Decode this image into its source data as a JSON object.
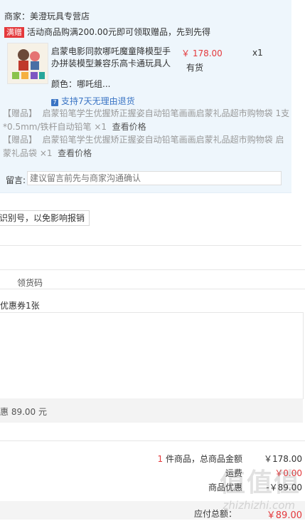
{
  "shop": {
    "label": "商家：美澄玩具专营店"
  },
  "promo": {
    "tag": "满赠",
    "text": "活动商品购满200.00元即可领取赠品，先到先得"
  },
  "product": {
    "title": "启蒙电影同款哪吒魔童降模型手办拼装模型兼容乐高卡通玩具人",
    "price": "￥ 178.00",
    "qty": "x1",
    "stock": "有货",
    "color": "颜色：哪吒组...",
    "return_policy": "支持7天无理由退货",
    "return_icon": "7"
  },
  "gifts": [
    {
      "prefix": "【赠品】",
      "name": "启蒙铅笔学生优握矫正握姿自动铅笔画画启蒙礼品超市购物袋 1支*0.5mm/铁杆自动铅笔 ×1",
      "link": "查看价格"
    },
    {
      "prefix": "【赠品】",
      "name": "启蒙铅笔学生优握矫正握姿自动铅笔画画启蒙礼品超市购物袋 启蒙礼品袋 ×1",
      "link": "查看价格"
    }
  ],
  "note": {
    "label": "留言:",
    "placeholder": "建议留言前先与商家沟通确认"
  },
  "tip": {
    "text": "识别号，以免影响报销"
  },
  "pickup": {
    "title": "领货码"
  },
  "coupon": {
    "summary": "优惠券1张",
    "discount": "惠 89.00 元"
  },
  "summary": {
    "count_prefix": "1",
    "count_text": " 件商品，总商品金额",
    "goods_total": "￥178.00",
    "row2_label": "运费",
    "row2_value": "￥0.00",
    "row3_label": "商品优惠",
    "row3_value": "-￥89.00",
    "total_label": "应付总额：",
    "total_value": "￥89.00"
  },
  "watermark": {
    "text": "值值值",
    "url": "zhizhizhi.com"
  },
  "colors": {
    "accent_red": "#e4393c",
    "link_blue": "#3a74c4",
    "panel_bg": "#eef6fc"
  }
}
